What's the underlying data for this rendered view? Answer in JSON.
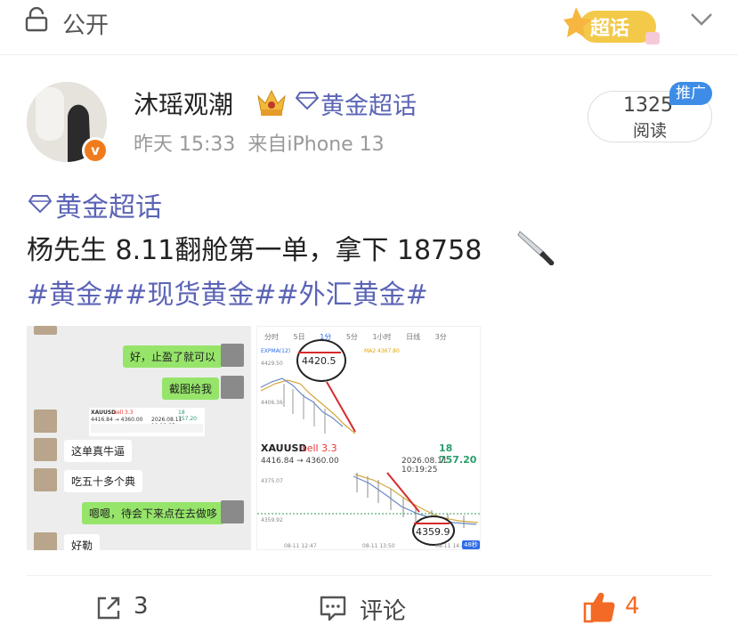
{
  "top_bar": {
    "visibility_label": "公开",
    "lock_icon": "lock-icon",
    "chaohua_label": "超话",
    "chevron_icon": "chevron-down-icon"
  },
  "post": {
    "username": "沐瑶观潮",
    "crown_icon": "crown-badge-icon",
    "topic_name": "黄金超话",
    "time": "昨天 15:33",
    "source": "来自iPhone 13",
    "reads_count": "1325",
    "reads_label": "阅读",
    "promo_label": "推广",
    "verified_mark": "v",
    "body_topic": "黄金超话",
    "body_text": "杨先生 8.11翻舱第一单，拿下 18758",
    "hashtags": "#黄金##现货黄金##外汇黄金#"
  },
  "chat_image": {
    "messages": [
      {
        "side": "me",
        "text": "好，止盈了就可以"
      },
      {
        "side": "me",
        "text": "截图给我"
      },
      {
        "side": "other",
        "text": "这单真牛逼"
      },
      {
        "side": "other",
        "text": "吃五十多个典"
      },
      {
        "side": "me",
        "text": "嗯嗯，待会下来点在去做哆"
      },
      {
        "side": "other",
        "text": "好勒"
      }
    ],
    "mini_card": {
      "symbol": "XAUUSD",
      "side": "sell 3.3",
      "profit": "18 757.20",
      "range": "4416.84 → 4360.00",
      "date": "2026.08.11 10:19:25"
    }
  },
  "trade_image": {
    "tabs": [
      "分时",
      "5日",
      "1分",
      "5分",
      "1小时",
      "日线",
      "3分"
    ],
    "indicator_label": "EXPMA(12)",
    "ma_label": "MA2 4367.80",
    "top_axis_value": "4429.50",
    "mid_axis_value": "4406.36",
    "entry_circle": "4420.5",
    "symbol": "XAUUSD",
    "side": "sell 3.3",
    "profit": "18 757.20",
    "range": "4416.84 → 4360.00",
    "date": "2026.08.11 10:19:25",
    "chart2_top_axis": "4375.07",
    "chart2_bottom_axis": "4359.92",
    "exit_circle": "4359.9",
    "time_labels": [
      "08-11 12:47",
      "08-11 13:50",
      "08-11 14:48"
    ],
    "countdown": "48秒"
  },
  "footer": {
    "share_icon": "share-icon",
    "share_count": "3",
    "comment_icon": "comment-icon",
    "comment_label": "评论",
    "like_icon": "thumbs-up-icon",
    "like_count": "4"
  },
  "colors": {
    "topic": "#5b64b5",
    "like": "#f26a25",
    "promo": "#3d8de6",
    "chat_me": "#96e56a"
  }
}
